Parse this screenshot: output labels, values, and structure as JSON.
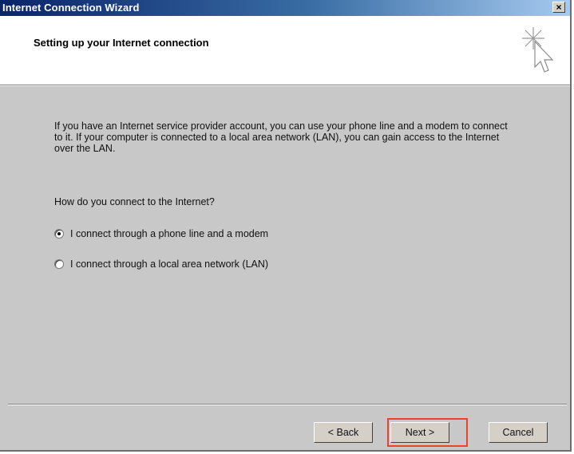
{
  "window": {
    "title": "Internet Connection Wizard",
    "close_glyph": "×"
  },
  "header": {
    "title": "Setting up your Internet connection",
    "icon": "wizard-cursor-icon"
  },
  "content": {
    "intro": "If you have an Internet service provider account, you can use your phone line and a modem to connect to it. If your computer is connected to a local area network (LAN), you can gain access to the Internet over the LAN.",
    "question": "How do you connect to the Internet?",
    "options": [
      {
        "label": "I connect through a phone line and a modem",
        "selected": true
      },
      {
        "label": "I connect through a local area network (LAN)",
        "selected": false
      }
    ]
  },
  "buttons": {
    "back": "< Back",
    "next": "Next >",
    "cancel": "Cancel"
  },
  "colors": {
    "highlight": "#e8432b",
    "titlebar": "#0a246a"
  }
}
